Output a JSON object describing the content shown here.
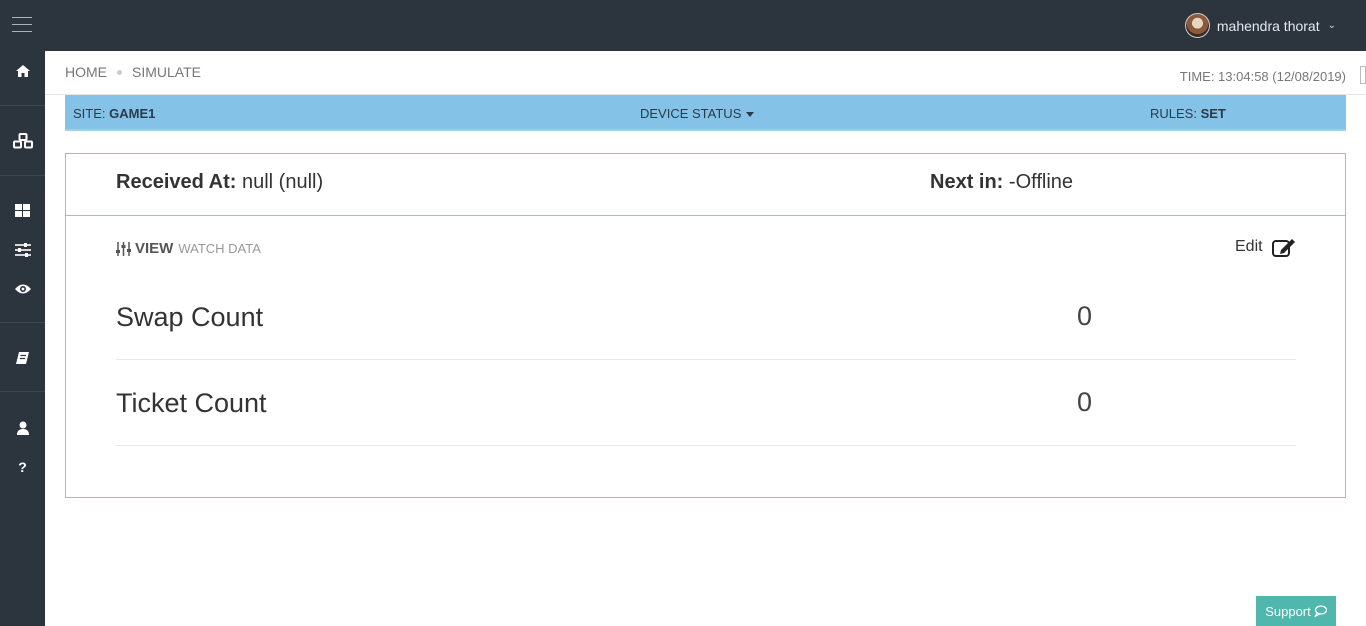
{
  "user": {
    "name": "mahendra thorat"
  },
  "breadcrumb": {
    "home": "HOME",
    "current": "SIMULATE"
  },
  "time_text": "TIME: 13:04:58 (12/08/2019)",
  "strip": {
    "site_label": "SITE:",
    "site_value": "GAME1",
    "device_status": "DEVICE STATUS",
    "rules_label": "RULES:",
    "rules_value": "SET"
  },
  "card": {
    "received_label": "Received At:",
    "received_value": "null (null)",
    "next_label": "Next in:",
    "next_value": "-Offline",
    "view_label": "VIEW",
    "view_sub": "WATCH DATA",
    "edit_label": "Edit",
    "rows": [
      {
        "label": "Swap Count",
        "value": "0"
      },
      {
        "label": "Ticket Count",
        "value": "0"
      }
    ]
  },
  "support_label": "Support",
  "sidebar_icons": [
    "home-icon",
    "cubes-icon",
    "dashboard-icon",
    "sliders-icon",
    "eye-icon",
    "book-icon",
    "user-icon",
    "help-icon"
  ],
  "colors": {
    "nav_bg": "#2c343d",
    "strip_bg": "#84c2e8",
    "card_border": "#8fc3dc",
    "support_bg": "#4fb7ab"
  }
}
